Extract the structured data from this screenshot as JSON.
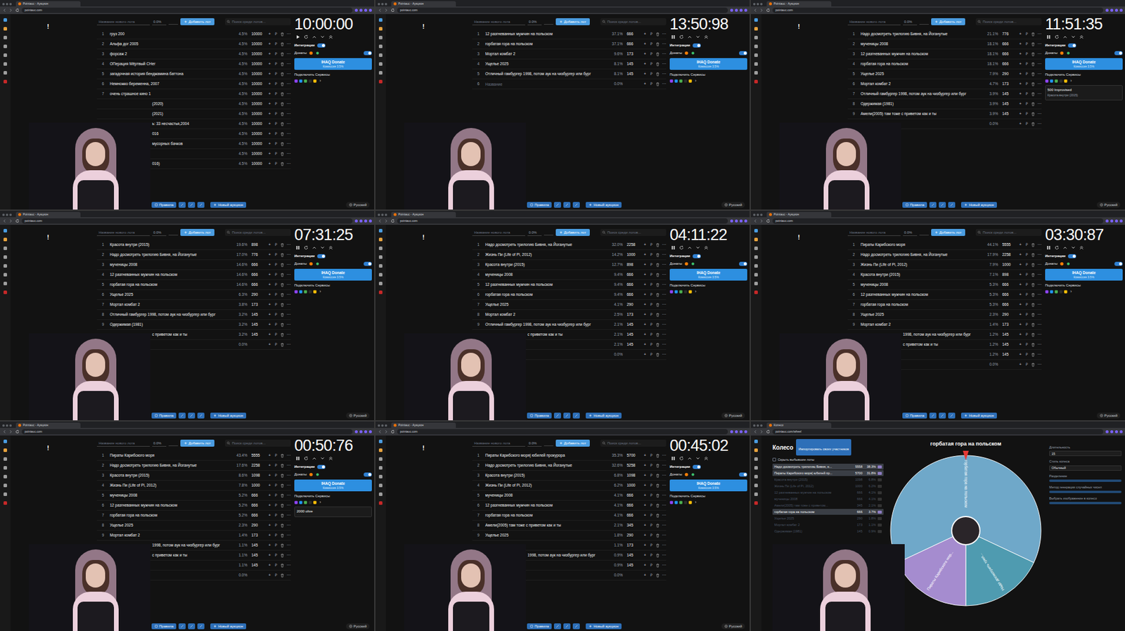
{
  "ui": {
    "tab_title": "Pointauc - Аукцион",
    "url": "pointauc.com",
    "alert": "!",
    "new_lot_placeholder": "Название нового лота",
    "new_lot_percent": "0.0%",
    "add_button": "Добавить лот",
    "search_placeholder": "Поиск среди лотов...",
    "integrations": "Интеграции",
    "integrations_on": true,
    "donations": "Донаты",
    "donations_on": true,
    "donate_button": "IHAQ Donate",
    "donate_note": "Комиссия 3.5%",
    "services": "Подключить Сервисы",
    "services_arrow": "›",
    "rules": "Правила",
    "new_auction": "Новый аукцион",
    "language": "Русский",
    "lot_actions": [
      "+",
      "₽",
      "⋯"
    ]
  },
  "frames": [
    {
      "timer": "10:00:00",
      "running": false,
      "lots": [
        {
          "rank": "1",
          "name": "груз 200",
          "percent": "4.5%",
          "amount": "10000"
        },
        {
          "rank": "2",
          "name": "Альфа дог 2005",
          "percent": "4.5%",
          "amount": "10000"
        },
        {
          "rank": "3",
          "name": "форсаж 2",
          "percent": "4.5%",
          "amount": "10000"
        },
        {
          "rank": "4",
          "name": "ОПерация Мёртвый СНег",
          "percent": "4.5%",
          "amount": "10000"
        },
        {
          "rank": "5",
          "name": "загадочная история бенджамина баттона",
          "percent": "4.5%",
          "amount": "10000"
        },
        {
          "rank": "6",
          "name": "Немножко беременна, 2007",
          "percent": "4.5%",
          "amount": "10000"
        },
        {
          "rank": "7",
          "name": "очень страшное кино 1",
          "percent": "4.5%",
          "amount": "10000"
        }
      ],
      "tail": [
        {
          "name": "(2020)",
          "percent": "4.5%",
          "amount": "10000"
        },
        {
          "name": "(2021)",
          "percent": "4.5%",
          "amount": "10000"
        },
        {
          "name": "ь: 33 несчастья,2004",
          "percent": "4.5%",
          "amount": "10000"
        },
        {
          "name": "016",
          "percent": "4.5%",
          "amount": "10000"
        },
        {
          "name": "мусорных бачков",
          "percent": "4.5%",
          "amount": "10000"
        },
        {
          "name": "",
          "percent": "4.5%",
          "amount": "10000"
        },
        {
          "name": "016)",
          "percent": "4.5%",
          "amount": "10000"
        }
      ]
    },
    {
      "timer": "13:50:98",
      "running": true,
      "lots": [
        {
          "rank": "1",
          "name": "12 разгневанных мужчин на польском",
          "percent": "37.1%",
          "amount": "666"
        },
        {
          "rank": "2",
          "name": "горбатая гора на польском",
          "percent": "37.1%",
          "amount": "666"
        },
        {
          "rank": "3",
          "name": "Мортал комбат 2",
          "percent": "9.6%",
          "amount": "173"
        },
        {
          "rank": "4",
          "name": "Ущелье 2025",
          "percent": "8.1%",
          "amount": "145"
        },
        {
          "rank": "5",
          "name": "Отличный гамбургер 1998, потом аук на чизбургер или бург",
          "percent": "8.1%",
          "amount": "145"
        }
      ],
      "empty_row": {
        "rank": "6",
        "placeholder": "Название",
        "percent": "0.0%"
      },
      "tail": []
    },
    {
      "timer": "11:51:35",
      "running": true,
      "lots": [
        {
          "rank": "1",
          "name": "Надо досмотреть трилогию Бивня, на Йоганутые",
          "percent": "21.1%",
          "amount": "776"
        },
        {
          "rank": "2",
          "name": "мученицы 2008",
          "percent": "18.1%",
          "amount": "666"
        },
        {
          "rank": "3",
          "name": "12 разгневанных мужчин на польском",
          "percent": "18.1%",
          "amount": "666"
        },
        {
          "rank": "4",
          "name": "горбатая гора на польском",
          "percent": "18.1%",
          "amount": "666"
        },
        {
          "rank": "5",
          "name": "Ущелье 2025",
          "percent": "7.9%",
          "amount": "290"
        },
        {
          "rank": "6",
          "name": "Мортал комбат 2",
          "percent": "4.7%",
          "amount": "173"
        },
        {
          "rank": "7",
          "name": "Отличный гамбургер 1998, потом аук на чизбургер или бург",
          "percent": "3.9%",
          "amount": "145"
        },
        {
          "rank": "8",
          "name": "Одержимая (1981)",
          "percent": "3.9%",
          "amount": "145"
        },
        {
          "rank": "9",
          "name": "Амели(2005) там тоже с приветом как и ты",
          "percent": "3.9%",
          "amount": "145"
        }
      ],
      "tail": [
        {
          "name": "",
          "percent": "0.0%",
          "amount": ""
        }
      ],
      "notice": {
        "title": "500 Improvised",
        "text": "Красота внутри (2015)"
      }
    },
    {
      "timer": "07:31:25",
      "running": true,
      "lots": [
        {
          "rank": "1",
          "name": "Красота внутри (2015)",
          "percent": "19.6%",
          "amount": "898"
        },
        {
          "rank": "2",
          "name": "Надо досмотреть трилогию Бивня, на Йоганутые",
          "percent": "17.0%",
          "amount": "776"
        },
        {
          "rank": "3",
          "name": "мученицы 2008",
          "percent": "14.6%",
          "amount": "666"
        },
        {
          "rank": "4",
          "name": "12 разгневанных мужчин на польском",
          "percent": "14.6%",
          "amount": "666"
        },
        {
          "rank": "5",
          "name": "горбатая гора на польском",
          "percent": "14.6%",
          "amount": "666"
        },
        {
          "rank": "6",
          "name": "Ущелье 2025",
          "percent": "6.3%",
          "amount": "290"
        },
        {
          "rank": "7",
          "name": "Мортал комбат 2",
          "percent": "3.8%",
          "amount": "173"
        },
        {
          "rank": "8",
          "name": "Отличный гамбургер 1998, потом аук на чизбургер или бург",
          "percent": "3.2%",
          "amount": "145"
        },
        {
          "rank": "9",
          "name": "Одержимая (1981)",
          "percent": "3.2%",
          "amount": "145"
        }
      ],
      "tail": [
        {
          "name": "с приветом как и ты",
          "percent": "3.2%",
          "amount": "145"
        },
        {
          "name": "",
          "percent": "0.0%",
          "amount": ""
        }
      ]
    },
    {
      "timer": "04:11:22",
      "running": true,
      "lots": [
        {
          "rank": "1",
          "name": "Надо досмотреть трилогию Бивня, на Йоганутые",
          "percent": "32.0%",
          "amount": "2258"
        },
        {
          "rank": "2",
          "name": "Жизнь Пи (Life of Pi, 2012)",
          "percent": "14.2%",
          "amount": "1000"
        },
        {
          "rank": "3",
          "name": "Красота внутри (2015)",
          "percent": "12.7%",
          "amount": "898"
        },
        {
          "rank": "4",
          "name": "мученицы 2008",
          "percent": "9.4%",
          "amount": "666"
        },
        {
          "rank": "5",
          "name": "12 разгневанных мужчин на польском",
          "percent": "9.4%",
          "amount": "666"
        },
        {
          "rank": "6",
          "name": "горбатая гора на польском",
          "percent": "9.4%",
          "amount": "666"
        },
        {
          "rank": "7",
          "name": "Ущелье 2025",
          "percent": "4.1%",
          "amount": "290"
        },
        {
          "rank": "8",
          "name": "Мортал комбат 2",
          "percent": "2.5%",
          "amount": "173"
        },
        {
          "rank": "9",
          "name": "Отличный гамбургер 1998, потом аук на чизбургер или бург",
          "percent": "2.1%",
          "amount": "145"
        }
      ],
      "tail": [
        {
          "name": "с приветом как и ты",
          "percent": "2.1%",
          "amount": "145"
        },
        {
          "name": "",
          "percent": "2.1%",
          "amount": "145"
        },
        {
          "name": "",
          "percent": "0.0%",
          "amount": ""
        }
      ]
    },
    {
      "timer": "03:30:87",
      "running": true,
      "lots": [
        {
          "rank": "1",
          "name": "Пираты Карибского моря",
          "percent": "44.1%",
          "amount": "5555"
        },
        {
          "rank": "2",
          "name": "Надо досмотреть трилогию Бивня, на Йоганутые",
          "percent": "17.9%",
          "amount": "2258"
        },
        {
          "rank": "3",
          "name": "Жизнь Пи (Life of Pi, 2012)",
          "percent": "7.9%",
          "amount": "1000"
        },
        {
          "rank": "4",
          "name": "Красота внутри (2015)",
          "percent": "7.1%",
          "amount": "898"
        },
        {
          "rank": "5",
          "name": "мученицы 2008",
          "percent": "5.3%",
          "amount": "666"
        },
        {
          "rank": "6",
          "name": "12 разгневанных мужчин на польском",
          "percent": "5.3%",
          "amount": "666"
        },
        {
          "rank": "7",
          "name": "горбатая гора на польском",
          "percent": "5.3%",
          "amount": "666"
        },
        {
          "rank": "8",
          "name": "Ущелье 2025",
          "percent": "2.3%",
          "amount": "290"
        },
        {
          "rank": "9",
          "name": "Мортал комбат 2",
          "percent": "1.4%",
          "amount": "173"
        }
      ],
      "tail": [
        {
          "name": "1998, потом аук на чизбургер или бург",
          "percent": "1.2%",
          "amount": "145"
        },
        {
          "name": "с приветом как и ты",
          "percent": "1.2%",
          "amount": "145"
        },
        {
          "name": "",
          "percent": "1.2%",
          "amount": "145"
        },
        {
          "name": "",
          "percent": "0.0%",
          "amount": ""
        }
      ]
    },
    {
      "timer": "00:50:76",
      "running": true,
      "lots": [
        {
          "rank": "1",
          "name": "Пираты Карибского моря",
          "percent": "43.4%",
          "amount": "5555"
        },
        {
          "rank": "2",
          "name": "Надо досмотреть трилогию Бивня, на Йоганутые",
          "percent": "17.6%",
          "amount": "2258"
        },
        {
          "rank": "3",
          "name": "Красота внутри (2015)",
          "percent": "8.6%",
          "amount": "1098"
        },
        {
          "rank": "4",
          "name": "Жизнь Пи (Life of Pi, 2012)",
          "percent": "7.8%",
          "amount": "1000"
        },
        {
          "rank": "5",
          "name": "мученицы 2008",
          "percent": "5.2%",
          "amount": "666"
        },
        {
          "rank": "6",
          "name": "12 разгневанных мужчин на польском",
          "percent": "5.2%",
          "amount": "666"
        },
        {
          "rank": "7",
          "name": "горбатая гора на польском",
          "percent": "5.2%",
          "amount": "666"
        },
        {
          "rank": "8",
          "name": "Ущелье 2025",
          "percent": "2.3%",
          "amount": "290"
        },
        {
          "rank": "9",
          "name": "Мортал комбат 2",
          "percent": "1.4%",
          "amount": "173"
        }
      ],
      "tail": [
        {
          "name": "1998, потом аук на чизбургер или бург",
          "percent": "1.1%",
          "amount": "145"
        },
        {
          "name": "с приветом как и ты",
          "percent": "1.1%",
          "amount": "145"
        },
        {
          "name": "",
          "percent": "1.1%",
          "amount": "145"
        },
        {
          "name": "",
          "percent": "0.0%",
          "amount": ""
        }
      ],
      "notice": {
        "title": "2000 olive",
        "text": ""
      }
    },
    {
      "timer": "00:45:02",
      "running": true,
      "lots": [
        {
          "rank": "1",
          "name": "Пираты Карибского моря| юбилей прокурора",
          "percent": "35.3%",
          "amount": "5700"
        },
        {
          "rank": "2",
          "name": "Надо досмотреть трилогию Бивня, на Йоганутые",
          "percent": "32.6%",
          "amount": "5258"
        },
        {
          "rank": "3",
          "name": "Красота внутри (2015)",
          "percent": "6.8%",
          "amount": "1098"
        },
        {
          "rank": "4",
          "name": "Жизнь Пи (Life of Pi, 2012)",
          "percent": "6.2%",
          "amount": "1000"
        },
        {
          "rank": "5",
          "name": "мученицы 2008",
          "percent": "4.1%",
          "amount": "666"
        },
        {
          "rank": "6",
          "name": "12 разгневанных мужчин на польском",
          "percent": "4.1%",
          "amount": "666"
        },
        {
          "rank": "7",
          "name": "горбатая гора на польском",
          "percent": "4.1%",
          "amount": "666"
        },
        {
          "rank": "8",
          "name": "Амели(2005) там тоже с приветом как и ты",
          "percent": "2.1%",
          "amount": "345"
        },
        {
          "rank": "9",
          "name": "Ущелье 2025",
          "percent": "1.8%",
          "amount": "290"
        }
      ],
      "tail": [
        {
          "name": "",
          "percent": "1.1%",
          "amount": "173"
        },
        {
          "name": "1998, потом аук на чизбургер или бург",
          "percent": "0.9%",
          "amount": "145"
        },
        {
          "name": "",
          "percent": "0.9%",
          "amount": "145"
        },
        {
          "name": "",
          "percent": "0.0%",
          "amount": ""
        }
      ]
    }
  ],
  "wheel": {
    "tab_title": "Колесо",
    "url": "pointauc.com/wheel",
    "heading": "Колесо",
    "import_button": "Импортировать своих участников",
    "hide_label": "Скрыть выбывшие лоты",
    "hide_checked": false,
    "title": "горбатая гора на польском",
    "lots": [
      {
        "name": "Надо досмотреть трилогию Бивня, н...",
        "amount": "5558",
        "percent": "38.3%",
        "active": true
      },
      {
        "name": "Пираты Карибского моря| юбилей пр...",
        "amount": "5700",
        "percent": "31.8%",
        "active": true
      },
      {
        "name": "Красота внутри (2015)",
        "amount": "1098",
        "percent": "6.8%",
        "active": false
      },
      {
        "name": "Жизнь Пи (Life of Pi, 2012)",
        "amount": "1000",
        "percent": "6.2%",
        "active": false
      },
      {
        "name": "12 разгневанных мужчин на польском",
        "amount": "666",
        "percent": "4.1%",
        "active": false
      },
      {
        "name": "мученицы 2008",
        "amount": "666",
        "percent": "4.1%",
        "active": false
      },
      {
        "name": "Амели(2005) там тоже с приветом...",
        "amount": "345",
        "percent": "2.1%",
        "active": false
      },
      {
        "name": "горбатая гора на польском",
        "amount": "666",
        "percent": "3.7%",
        "active": true
      },
      {
        "name": "Ущелье 2025",
        "amount": "290",
        "percent": "1.8%",
        "active": false
      },
      {
        "name": "Мортал комбат 2",
        "amount": "173",
        "percent": "1.1%",
        "active": false
      },
      {
        "name": "Одержимая (1981)",
        "amount": "145",
        "percent": "0.9%",
        "active": false
      }
    ],
    "slices": [
      {
        "label": "горбатая гора на польском",
        "share": 0.64,
        "color": "#6fa8c9"
      },
      {
        "label": "Надо досмотреть трил...",
        "share": 0.18,
        "color": "#4f9bb0"
      },
      {
        "label": "Пираты Карибского мор...",
        "share": 0.18,
        "color": "#a58ccf"
      }
    ],
    "settings": [
      {
        "label": "Длительность",
        "value": "15"
      },
      {
        "label": "Стиль колеса",
        "value": "Обычный"
      },
      {
        "label": "Разделение",
        "value": ""
      },
      {
        "label": "Метод генерации случайных чисел",
        "value": ""
      },
      {
        "label": "Выбрать изображение в колесо",
        "value": ""
      }
    ]
  }
}
